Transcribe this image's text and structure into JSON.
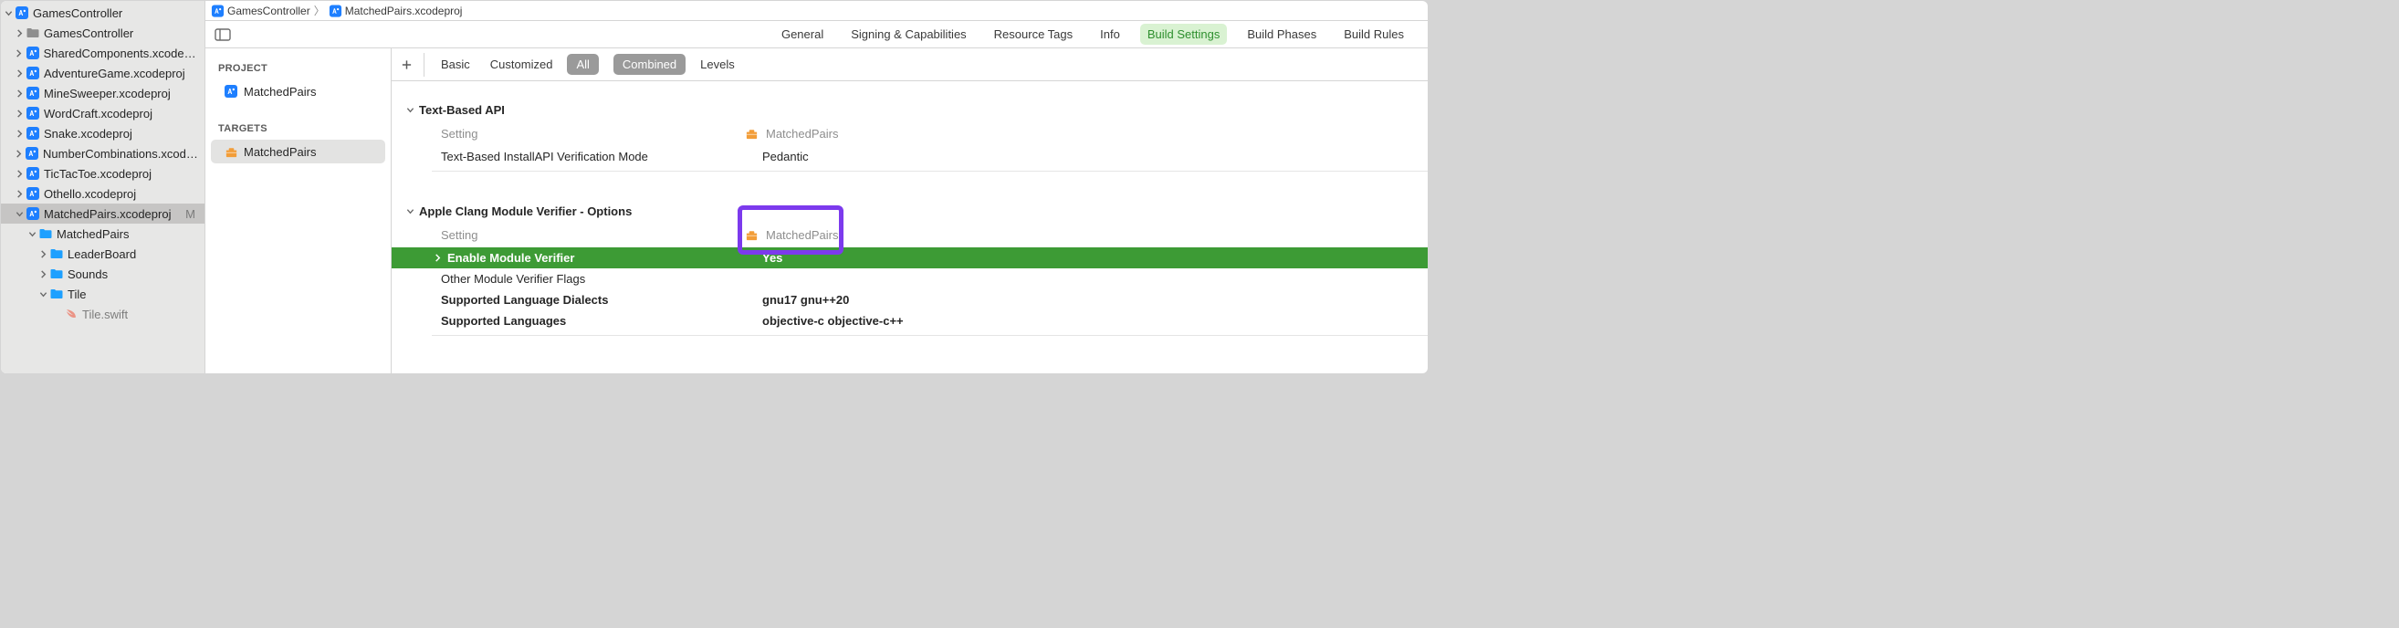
{
  "sidebar": {
    "root": "GamesController",
    "items": [
      {
        "label": "GamesController",
        "type": "folder"
      },
      {
        "label": "SharedComponents.xcodeproj",
        "type": "proj"
      },
      {
        "label": "AdventureGame.xcodeproj",
        "type": "proj"
      },
      {
        "label": "MineSweeper.xcodeproj",
        "type": "proj"
      },
      {
        "label": "WordCraft.xcodeproj",
        "type": "proj"
      },
      {
        "label": "Snake.xcodeproj",
        "type": "proj"
      },
      {
        "label": "NumberCombinations.xcodeproj",
        "type": "proj"
      },
      {
        "label": "TicTacToe.xcodeproj",
        "type": "proj"
      },
      {
        "label": "Othello.xcodeproj",
        "type": "proj"
      }
    ],
    "selected": {
      "label": "MatchedPairs.xcodeproj",
      "status": "M"
    },
    "children": [
      {
        "label": "MatchedPairs",
        "type": "folder",
        "expanded": true,
        "depth": 1
      },
      {
        "label": "LeaderBoard",
        "type": "folder",
        "expanded": false,
        "depth": 2
      },
      {
        "label": "Sounds",
        "type": "folder",
        "expanded": false,
        "depth": 2
      },
      {
        "label": "Tile",
        "type": "folder",
        "expanded": true,
        "depth": 2
      },
      {
        "label": "Tile.swift",
        "type": "swift",
        "expanded": null,
        "depth": 3
      }
    ]
  },
  "breadcrumb": {
    "item1": "GamesController",
    "item2": "MatchedPairs.xcodeproj"
  },
  "tabs": [
    "General",
    "Signing & Capabilities",
    "Resource Tags",
    "Info",
    "Build Settings",
    "Build Phases",
    "Build Rules"
  ],
  "active_tab": "Build Settings",
  "project_targets": {
    "project_heading": "PROJECT",
    "project": "MatchedPairs",
    "targets_heading": "TARGETS",
    "target": "MatchedPairs"
  },
  "filter": {
    "basic": "Basic",
    "customized": "Customized",
    "all": "All",
    "combined": "Combined",
    "levels": "Levels"
  },
  "sections": {
    "s1": {
      "title": "Text-Based API",
      "col_setting": "Setting",
      "col_target": "MatchedPairs",
      "rows": [
        {
          "name": "Text-Based InstallAPI Verification Mode",
          "value": "Pedantic"
        }
      ]
    },
    "s2": {
      "title": "Apple Clang Module Verifier - Options",
      "col_setting": "Setting",
      "col_target": "MatchedPairs",
      "rows": [
        {
          "name": "Enable Module Verifier",
          "value": "Yes",
          "selected": true
        },
        {
          "name": "Other Module Verifier Flags",
          "value": ""
        },
        {
          "name": "Supported Language Dialects",
          "value": "gnu17 gnu++20",
          "bold": true
        },
        {
          "name": "Supported Languages",
          "value": "objective-c objective-c++",
          "bold": true
        }
      ]
    }
  }
}
